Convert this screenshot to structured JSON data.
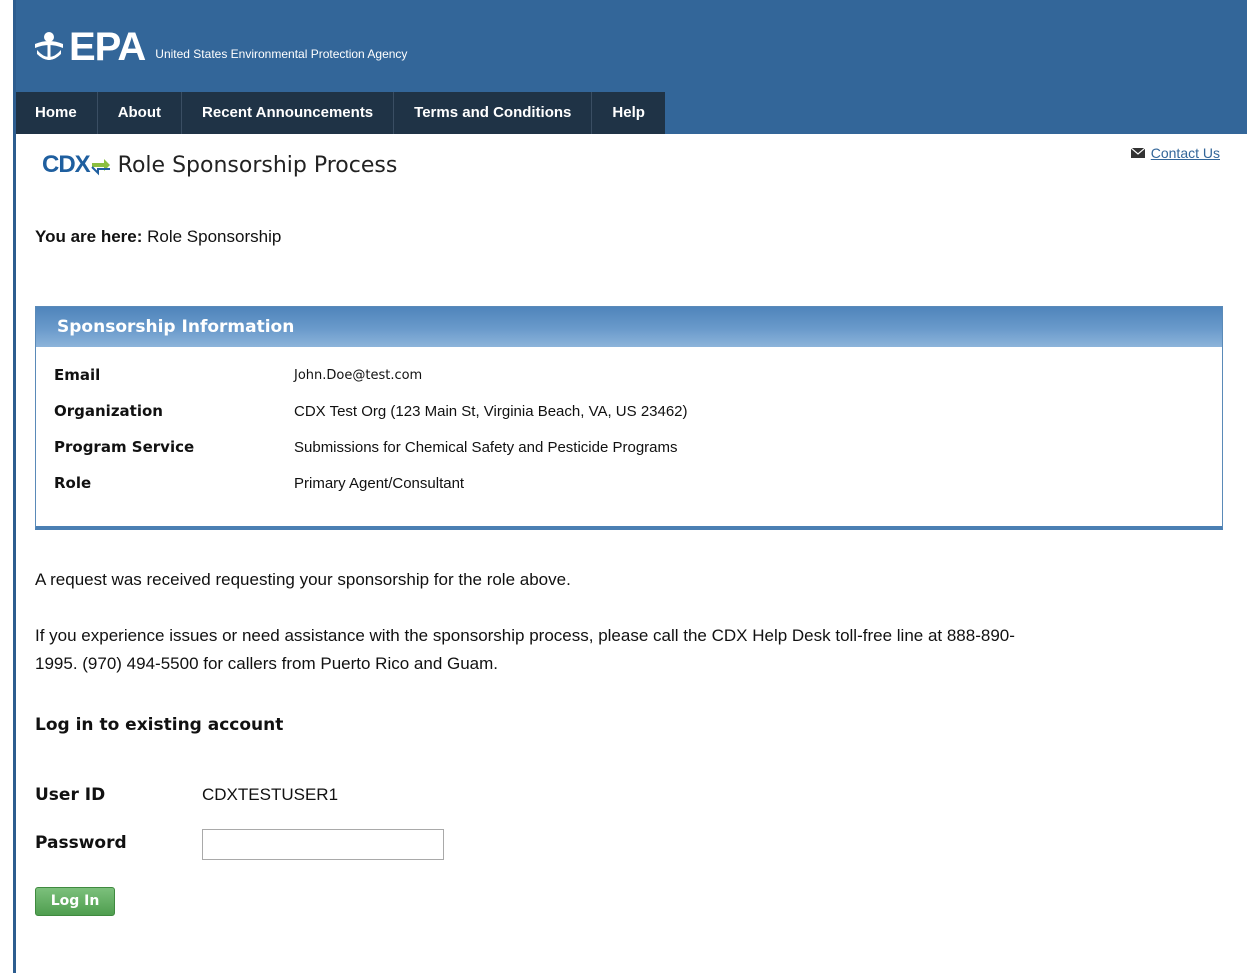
{
  "header": {
    "logo_text": "EPA",
    "agency_name": "United States Environmental Protection Agency"
  },
  "nav": {
    "items": [
      {
        "label": "Home"
      },
      {
        "label": "About"
      },
      {
        "label": "Recent Announcements"
      },
      {
        "label": "Terms and Conditions"
      },
      {
        "label": "Help"
      }
    ]
  },
  "page": {
    "cdx_logo_text": "CDX",
    "title": "Role Sponsorship Process",
    "contact_label": "Contact Us",
    "breadcrumb_prefix": "You are here:",
    "breadcrumb_current": "Role Sponsorship"
  },
  "sponsorship": {
    "heading": "Sponsorship Information",
    "rows": [
      {
        "key": "Email",
        "value": "John.Doe@test.com"
      },
      {
        "key": "Organization",
        "value": "CDX Test Org (123 Main St, Virginia Beach, VA, US 23462)"
      },
      {
        "key": "Program Service",
        "value": "Submissions for Chemical Safety and Pesticide Programs"
      },
      {
        "key": "Role",
        "value": "Primary Agent/Consultant"
      }
    ]
  },
  "messages": {
    "request_received": "A request was received requesting your sponsorship for the role above.",
    "help_line_1": "If you experience issues or need assistance with the sponsorship process, please call the CDX Help Desk toll-free line at 888-890-",
    "help_line_2": "1995. (970) 494-5500 for callers from Puerto Rico and Guam."
  },
  "login": {
    "section_title": "Log in to existing account",
    "user_id_label": "User ID",
    "user_id_value": "CDXTESTUSER1",
    "password_label": "Password",
    "password_value": "",
    "button_label": "Log In"
  },
  "colors": {
    "header_blue": "#336699",
    "nav_dark": "#1f3346",
    "panel_blue": "#4f84bb",
    "button_green": "#4f9e4f",
    "link_blue": "#336699"
  }
}
